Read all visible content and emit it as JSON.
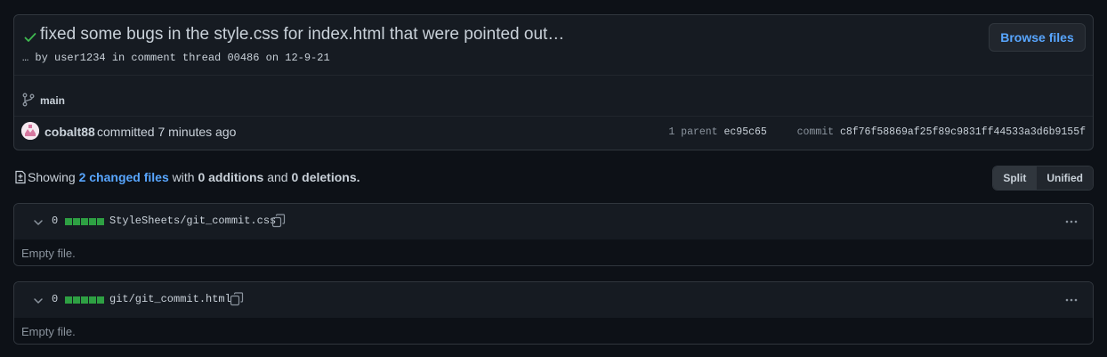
{
  "commit": {
    "title": "fixed some bugs in the style.css for index.html that were pointed out…",
    "description": "… by user1234 in comment thread 00486 on 12-9-21",
    "browse_label": "Browse files",
    "branch": "main",
    "author": "cobalt88",
    "committed_text": "committed 7 minutes ago",
    "parent_label": "1 parent",
    "parent_sha": "ec95c65",
    "commit_label": "commit",
    "commit_sha": "c8f76f58869af25f89c9831ff44533a3d6b9155f"
  },
  "summary": {
    "showing": "Showing",
    "changed_files": "2 changed files",
    "with": "with",
    "additions": "0 additions",
    "and": "and",
    "deletions": "0 deletions.",
    "split_label": "Split",
    "unified_label": "Unified"
  },
  "files": [
    {
      "count": "0",
      "name": "StyleSheets/git_commit.css",
      "body": "Empty file."
    },
    {
      "count": "0",
      "name": "git/git_commit.html",
      "body": "Empty file."
    }
  ],
  "colors": {
    "background": "#0d1117",
    "panel": "#161b22",
    "border": "#30363d",
    "link": "#58a6ff",
    "success": "#3fb950",
    "diffstat": "#2ea043"
  },
  "icons": [
    "check-icon",
    "git-branch-icon",
    "avatar",
    "file-diff-icon",
    "chevron-down-icon",
    "copy-icon",
    "kebab-horizontal-icon"
  ]
}
